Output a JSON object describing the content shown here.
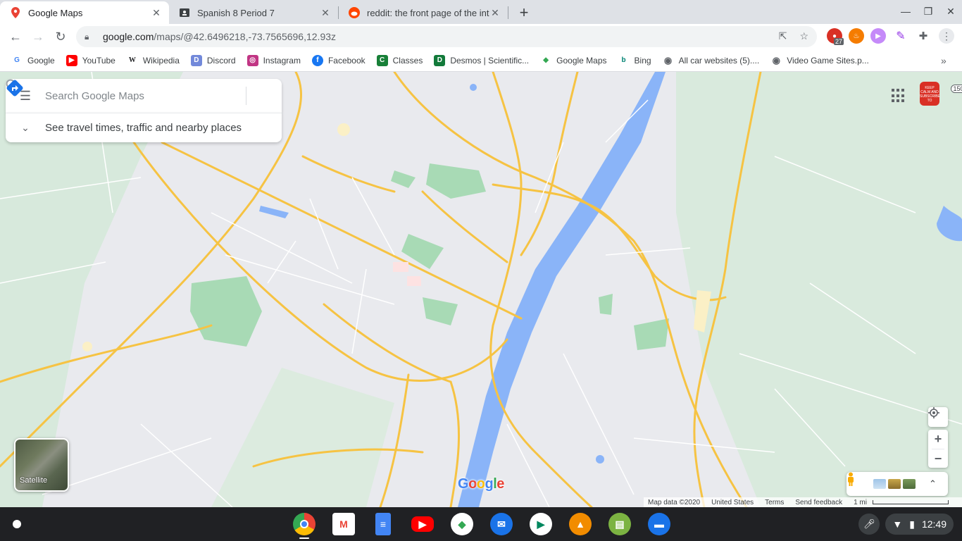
{
  "tabs": [
    {
      "title": "Google Maps",
      "active": true,
      "icon": "maps-pin-icon"
    },
    {
      "title": "Spanish 8 Period 7",
      "active": false,
      "icon": "classroom-icon"
    },
    {
      "title": "reddit: the front page of the inter",
      "active": false,
      "icon": "reddit-icon"
    }
  ],
  "omnibox": {
    "host": "google.com",
    "path": "/maps/@42.6496218,-73.7565696,12.93z"
  },
  "extensions": {
    "badge_count": "27"
  },
  "bookmarks": [
    {
      "label": "Google",
      "color": "#4285f4",
      "glyph": "G"
    },
    {
      "label": "YouTube",
      "color": "#ff0000",
      "glyph": "▶"
    },
    {
      "label": "Wikipedia",
      "color": "#ffffff",
      "glyph": "W"
    },
    {
      "label": "Discord",
      "color": "#7289da",
      "glyph": "D"
    },
    {
      "label": "Instagram",
      "color": "#c13584",
      "glyph": "◎"
    },
    {
      "label": "Facebook",
      "color": "#1877f2",
      "glyph": "f"
    },
    {
      "label": "Classes",
      "color": "#188038",
      "glyph": "C"
    },
    {
      "label": "Desmos | Scientific...",
      "color": "#127a3a",
      "glyph": "D"
    },
    {
      "label": "Google Maps",
      "color": "#34a853",
      "glyph": "◆"
    },
    {
      "label": "Bing",
      "color": "#008373",
      "glyph": "b"
    },
    {
      "label": "All car websites (5)....",
      "color": "#5f6368",
      "glyph": "◉"
    },
    {
      "label": "Video Game Sites.p...",
      "color": "#5f6368",
      "glyph": "◉"
    }
  ],
  "search": {
    "placeholder": "Search Google Maps"
  },
  "travel": {
    "label": "See travel times, traffic and nearby places"
  },
  "avatar": {
    "text": "KEEP CALM AND SUBSCRIBE TO"
  },
  "edge_label": "150",
  "satellite": {
    "label": "Satellite"
  },
  "map_footer": {
    "map_data": "Map data ©2020",
    "country": "United States",
    "terms": "Terms",
    "feedback": "Send feedback",
    "scale": "1 mi"
  },
  "google_logo": "Google",
  "shelf": {
    "apps": [
      {
        "name": "Chrome",
        "color": "#4285f4",
        "glyph": "◉"
      },
      {
        "name": "Gmail",
        "color": "#ea4335",
        "glyph": "M"
      },
      {
        "name": "Docs",
        "color": "#4285f4",
        "glyph": "≡"
      },
      {
        "name": "YouTube",
        "color": "#ff0000",
        "glyph": "▶"
      },
      {
        "name": "Maps",
        "color": "#34a853",
        "glyph": "◆"
      },
      {
        "name": "Messages",
        "color": "#1a73e8",
        "glyph": "✉"
      },
      {
        "name": "Play Store",
        "color": "#01875f",
        "glyph": "▶"
      },
      {
        "name": "VLC",
        "color": "#f28c00",
        "glyph": "▲"
      },
      {
        "name": "Books",
        "color": "#7cb342",
        "glyph": "▤"
      },
      {
        "name": "Files",
        "color": "#1a73e8",
        "glyph": "▬"
      }
    ],
    "time": "12:49"
  },
  "colors": {
    "road": "#f6c343",
    "water": "#8ab4f8",
    "park": "#a8dab5",
    "land": "#e9eaee"
  }
}
